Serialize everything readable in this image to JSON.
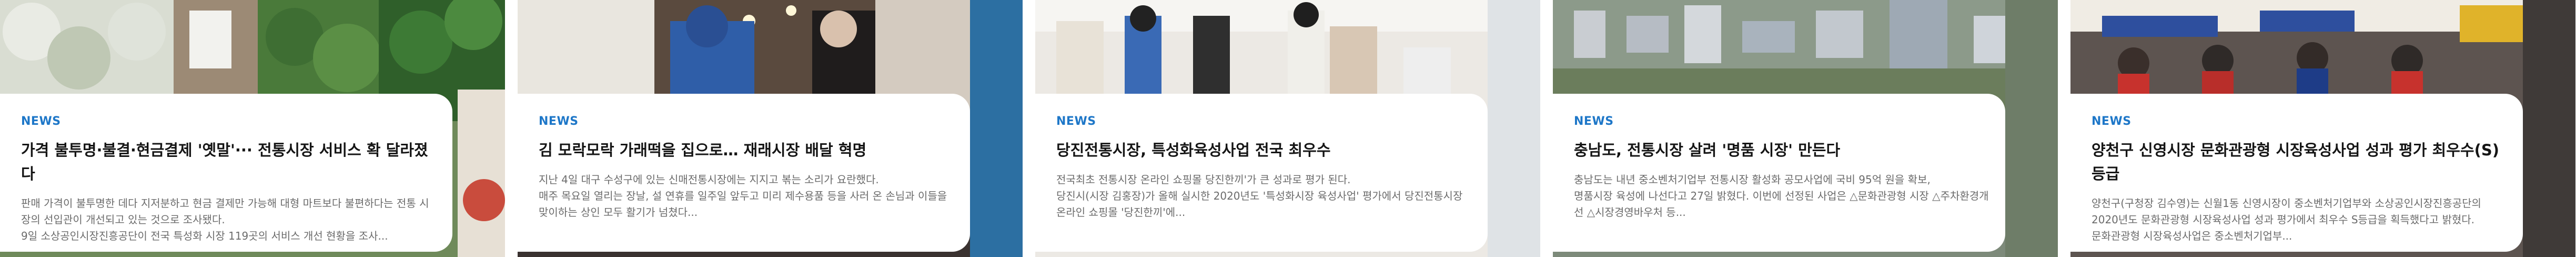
{
  "cards": [
    {
      "tag": "NEWS",
      "title": "가격 불투명·불결·현금결제 '옛말'··· 전통시장 서비스 확 달라졌다",
      "desc": "판매 가격이 불투명한 데다 지저분하고 현금 결제만 가능해 대형 마트보다 불편하다는 전통 시장의 선입관이 개선되고 있는 것으로 조사됐다.\n9일 소상공인시장진흥공단이 전국 특성화 시장 119곳의 서비스 개선 현황을 조사..."
    },
    {
      "tag": "NEWS",
      "title": "김 모락모락 가래떡을 집으로… 재래시장 배달 혁명",
      "desc": "지난 4일 대구 수성구에 있는 신매전통시장에는 지지고 볶는 소리가 요란했다.\n매주 목요일 열리는 장날, 설 연휴를 일주일 앞두고 미리 제수용품 등을 사러 온 손님과 이들을 맞이하는 상인 모두 활기가 넘쳤다..."
    },
    {
      "tag": "NEWS",
      "title": "당진전통시장, 특성화육성사업 전국 최우수",
      "desc": "전국최초 전통시장 온라인 쇼핑몰 당진한끼'가 큰 성과로 평가 된다.\n당진시(시장 김홍장)가 올해 실시한 2020년도 '특성화시장 육성사업' 평가에서 당진전통시장 온라인 쇼핑몰 '당진한끼'에..."
    },
    {
      "tag": "NEWS",
      "title": "충남도, 전통시장 살려 '명품 시장' 만든다",
      "desc": "충남도는 내년 중소벤처기업부 전통시장 활성화 공모사업에 국비 95억 원을 확보,\n명품시장 육성에 나선다고 27일 밝혔다. 이번에 선정된 사업은 △문화관광형 시장 △주차환경개선 △시장경영바우처 등..."
    },
    {
      "tag": "NEWS",
      "title": "양천구 신영시장 문화관광형 시장육성사업 성과 평가 최우수(S)등급",
      "desc": "양천구(구청장 김수영)는 신월1동 신영시장이 중소벤처기업부와 소상공인시장진흥공단의 2020년도 문화관광형 시장육성사업 성과 평가에서 최우수 S등급을 획득했다고 밝혔다.\n문화관광형 시장육성사업은 중소벤처기업부..."
    }
  ],
  "photo_icons": [
    "market-vegetables-photo",
    "market-vendor-photo",
    "market-kitchen-photo",
    "aerial-city-photo",
    "market-ceremony-photo"
  ]
}
